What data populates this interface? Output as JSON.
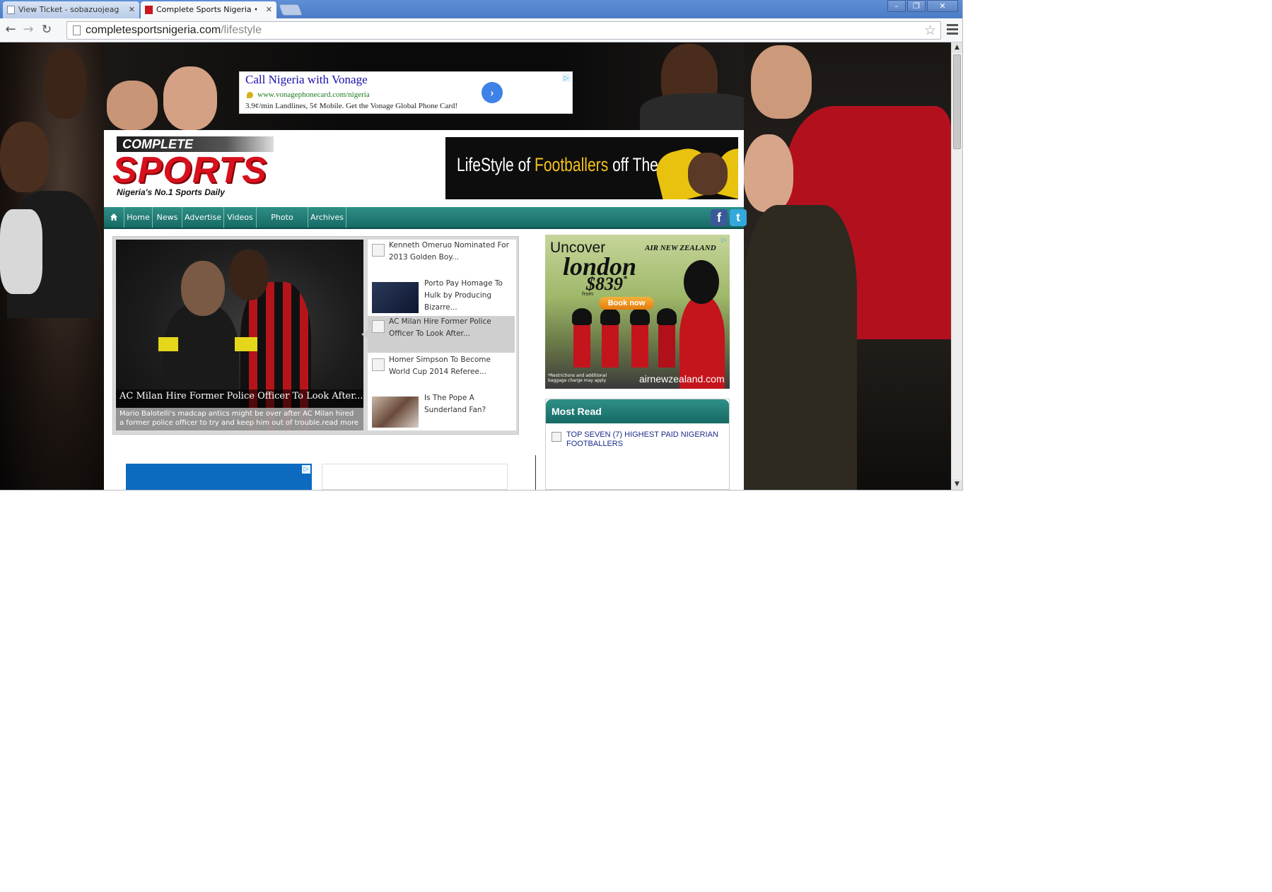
{
  "browser": {
    "tabs": [
      {
        "title": "View Ticket - sobazuojeagb",
        "active": false
      },
      {
        "title": "Complete Sports Nigeria • Lif",
        "active": true
      }
    ],
    "url_host": "completesportsnigeria.com",
    "url_path": "/lifestyle",
    "window_buttons": {
      "minimize": "–",
      "restore": "❐",
      "close": "✕"
    },
    "nav_icons": {
      "back": "back-arrow-icon",
      "forward": "forward-arrow-icon",
      "reload": "reload-icon",
      "bookmark": "star-icon",
      "menu": "menu-icon"
    }
  },
  "top_ad": {
    "title": "Call Nigeria with Vonage",
    "url": "www.vonagephonecard.com/nigeria",
    "description": "3.9¢/min Landlines, 5¢ Mobile. Get the Vonage Global Phone Card!"
  },
  "logo": {
    "top": "COMPLETE",
    "main": "SPORTS",
    "tagline": "Nigeria's No.1 Sports Daily"
  },
  "banner": {
    "part1": "LifeStyle of ",
    "highlight": "Footballers",
    "part2": " off The Pitch"
  },
  "nav": {
    "items": [
      "Home",
      "News",
      "Advertise",
      "Videos",
      "Photo gallery",
      "Archives"
    ],
    "social": [
      "f",
      "t"
    ]
  },
  "slider": {
    "featured_title": "AC Milan Hire Former Police Officer To Look After...",
    "featured_desc": "Mario Balotelli's madcap antics might be over after AC Milan hired a former police officer to try and keep him out of trouble.read more",
    "items": [
      {
        "title": "Kenneth Omeruo Nominated For 2013 Golden Boy..."
      },
      {
        "title": "Porto Pay Homage To Hulk by Producing Bizarre..."
      },
      {
        "title": "AC Milan Hire Former Police Officer To Look After..."
      },
      {
        "title": "Homer Simpson To Become World Cup 2014 Referee..."
      },
      {
        "title": "Is The Pope A Sunderland Fan?"
      }
    ]
  },
  "right_ad": {
    "uncover": "Uncover",
    "city": "london",
    "from": "from",
    "price": "$839",
    "price_mark": "*",
    "airline": "AIR NEW ZEALAND",
    "cta": "Book now",
    "fine_print": "*Restrictions and additional baggage charge may apply",
    "site": "airnewzealand.com"
  },
  "most_read": {
    "heading": "Most Read",
    "items": [
      "TOP SEVEN (7) HIGHEST PAID NIGERIAN FOOTBALLERS"
    ]
  },
  "colors": {
    "nav_teal": "#166a64",
    "logo_red": "#d8101c",
    "link_blue": "#1a2c8c",
    "chrome_blue": "#4a7cc7"
  }
}
